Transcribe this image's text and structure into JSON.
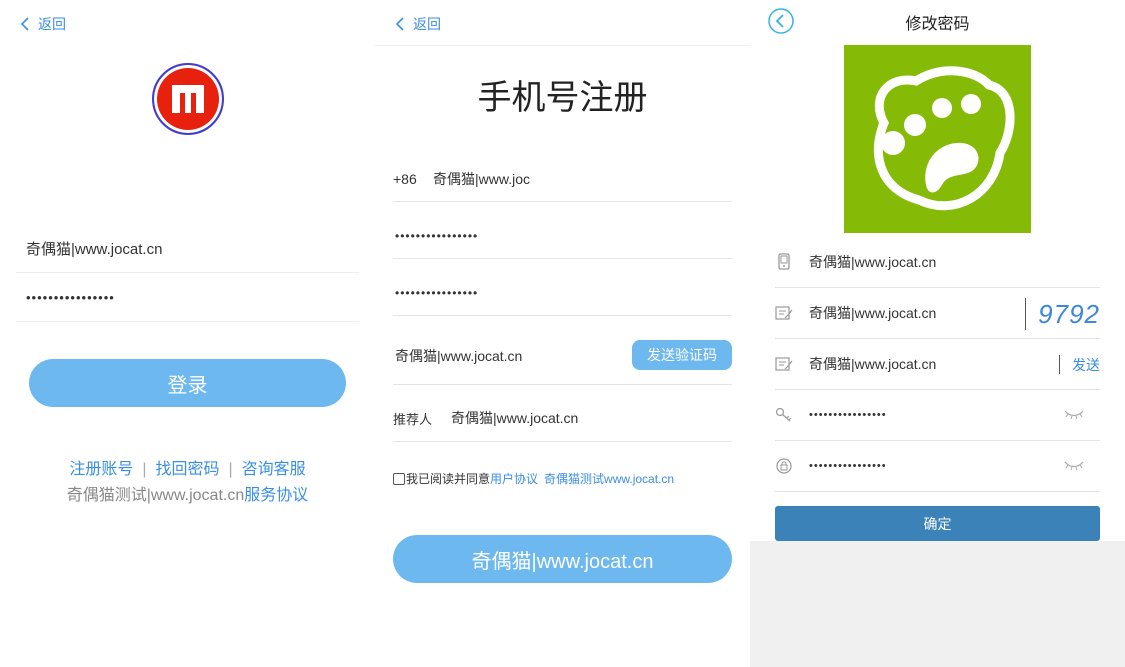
{
  "login": {
    "back_label": "返回",
    "username_value": "奇偶猫|www.jocat.cn",
    "password_value": "••••••••••••••••",
    "login_button": "登录",
    "links": [
      "注册账号",
      "找回密码",
      "咨询客服"
    ],
    "agreement_prefix": "奇偶猫测试|www.jocat.cn",
    "agreement_link": "服务协议",
    "logo_color": "#e8210f"
  },
  "register": {
    "back_label": "返回",
    "title": "手机号注册",
    "country_code": "+86",
    "phone_value": "奇偶猫|www.joc",
    "password_value": "••••••••••••••••",
    "confirm_password_value": "••••••••••••••••",
    "code_value": "奇偶猫|www.jocat.cn",
    "send_code_button": "发送验证码",
    "referrer_label": "推荐人",
    "referrer_value": "奇偶猫|www.jocat.cn",
    "agree_text": "我已阅读并同意",
    "agree_link_1": "用户协议",
    "agree_link_2": "奇偶猫测试www.jocat.cn",
    "submit_button": "奇偶猫|www.jocat.cn",
    "accent_color": "#6cb8ef"
  },
  "change_password": {
    "title": "修改密码",
    "app_icon_color": "#85bb06",
    "phone_value": "奇偶猫|www.jocat.cn",
    "captcha_input_value": "奇偶猫|www.jocat.cn",
    "captcha_text": "9792",
    "sms_code_value": "奇偶猫|www.jocat.cn",
    "send_label": "发送",
    "new_password_value": "••••••••••••••••",
    "confirm_password_value": "••••••••••••••••",
    "confirm_button": "确定",
    "button_color": "#3a82b8"
  }
}
